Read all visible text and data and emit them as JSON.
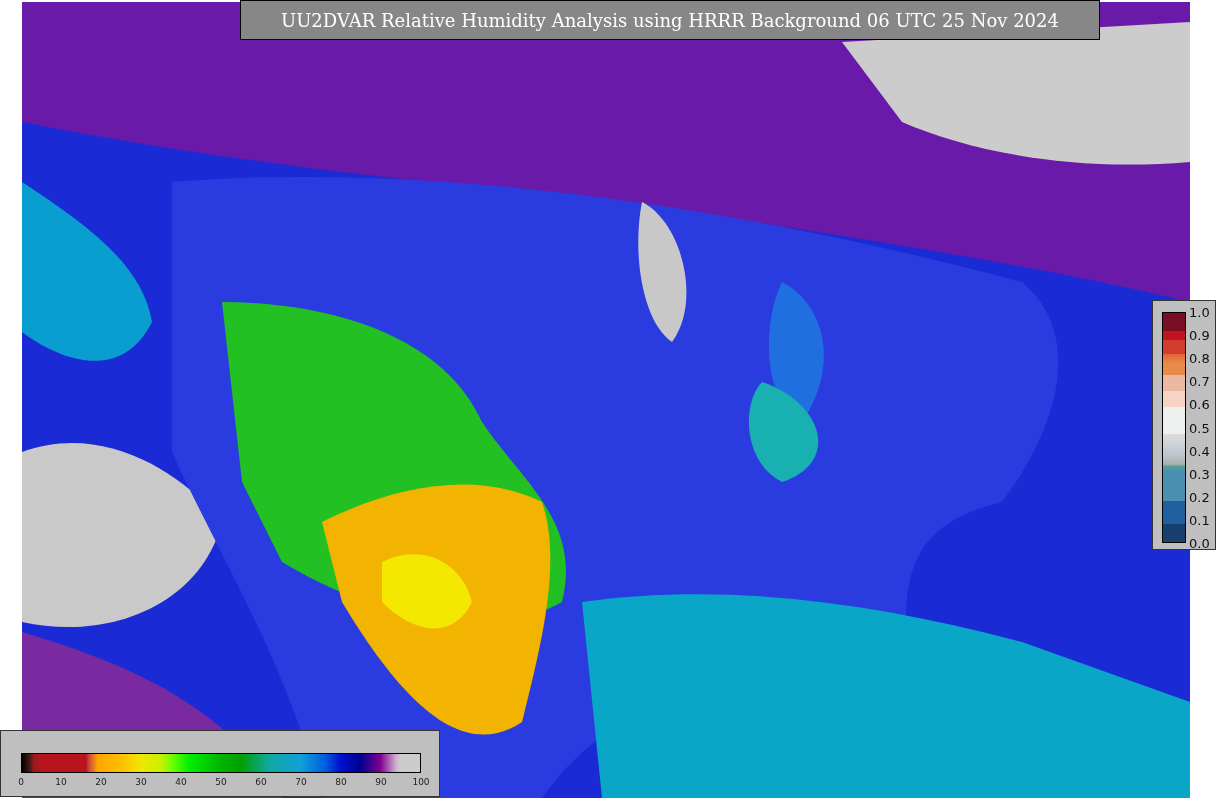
{
  "title": "UU2DVAR Relative Humidity Analysis using HRRR Background 06 UTC 25 Nov 2024",
  "humidity_colorbar": {
    "ticks": [
      "0",
      "10",
      "20",
      "30",
      "40",
      "50",
      "60",
      "70",
      "80",
      "90",
      "100"
    ]
  },
  "error_colorbar": {
    "ticks": [
      "1.0",
      "0.9",
      "0.8",
      "0.7",
      "0.6",
      "0.5",
      "0.4",
      "0.3",
      "0.2",
      "0.1",
      "0.0"
    ]
  }
}
